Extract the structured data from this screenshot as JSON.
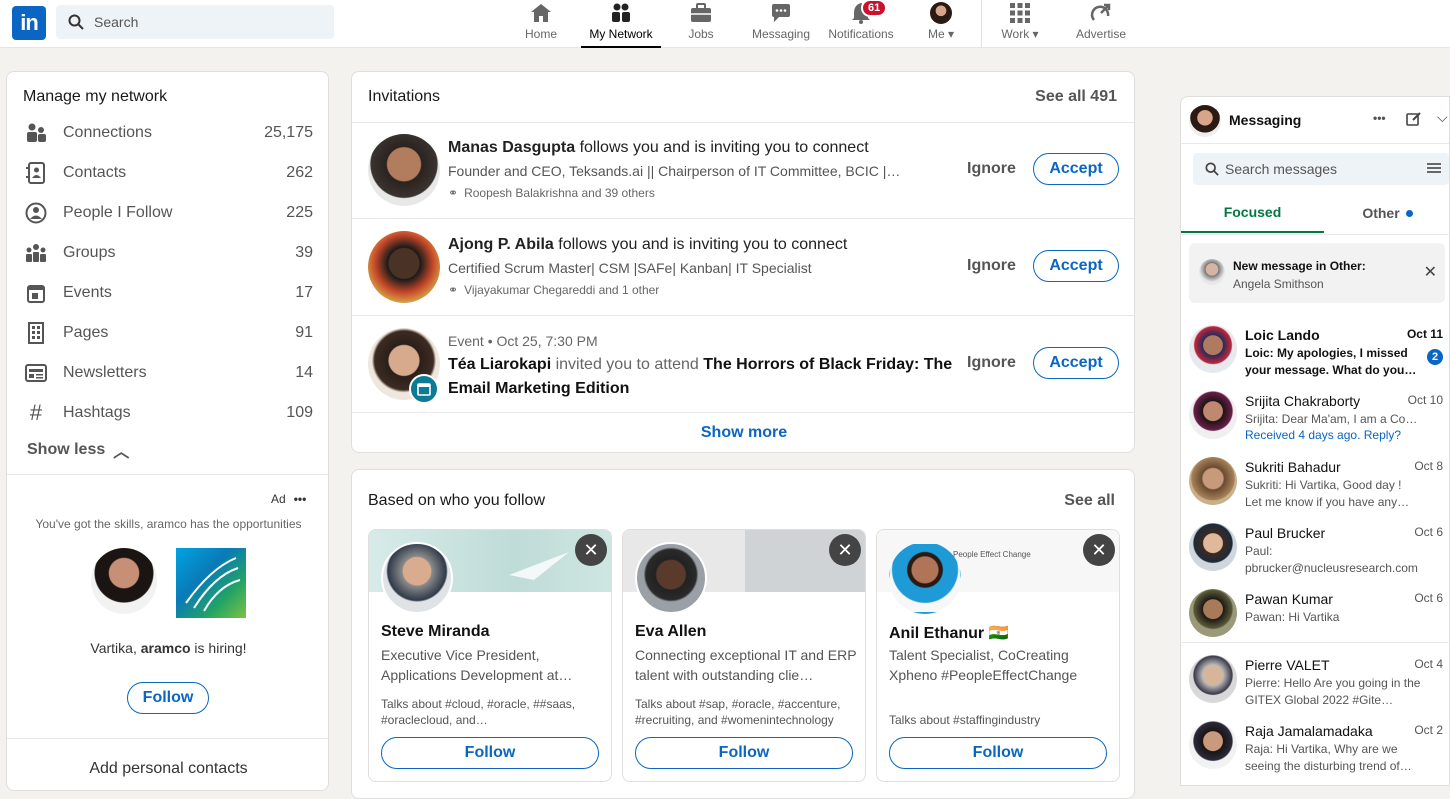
{
  "topnav": {
    "logo": "in",
    "search_placeholder": "Search",
    "items": [
      {
        "label": "Home"
      },
      {
        "label": "My Network"
      },
      {
        "label": "Jobs"
      },
      {
        "label": "Messaging"
      },
      {
        "label": "Notifications",
        "badge": "61"
      },
      {
        "label": "Me"
      },
      {
        "label": "Work"
      },
      {
        "label": "Advertise"
      }
    ]
  },
  "manage": {
    "title": "Manage my network",
    "items": [
      {
        "label": "Connections",
        "count": "25,175"
      },
      {
        "label": "Contacts",
        "count": "262"
      },
      {
        "label": "People I Follow",
        "count": "225"
      },
      {
        "label": "Groups",
        "count": "39"
      },
      {
        "label": "Events",
        "count": "17"
      },
      {
        "label": "Pages",
        "count": "91"
      },
      {
        "label": "Newsletters",
        "count": "14"
      },
      {
        "label": "Hashtags",
        "count": "109"
      }
    ],
    "show_less": "Show less"
  },
  "ad": {
    "label": "Ad",
    "tagline": "You've got the skills, aramco has the opportunities",
    "hiring_prefix": "Vartika, ",
    "hiring_company": "aramco",
    "hiring_suffix": " is hiring!",
    "follow": "Follow",
    "add_contacts": "Add personal contacts"
  },
  "invitations": {
    "title": "Invitations",
    "see_all": "See all 491",
    "ignore": "Ignore",
    "accept": "Accept",
    "show_more": "Show more",
    "items": [
      {
        "name": "Manas Dasgupta",
        "action": " follows you and is inviting you to connect",
        "headline": "Founder and CEO, Teksands.ai || Chairperson of IT Committee, BCIC ||…",
        "mutual": "Roopesh Balakrishna and 39 others"
      },
      {
        "name": "Ajong P. Abila",
        "action": " follows you and is inviting you to connect",
        "headline": "Certified Scrum Master| CSM |SAFe| Kanban| IT Specialist",
        "mutual": "Vijayakumar Chegareddi and 1 other"
      },
      {
        "event_meta": "Event • Oct 25, 7:30 PM",
        "name": "Téa Liarokapi",
        "action": " invited you to attend ",
        "event_title": "The Horrors of Black Friday: The Email Marketing Edition"
      }
    ]
  },
  "follow_section": {
    "title": "Based on who you follow",
    "see_all": "See all",
    "follow": "Follow",
    "cards": [
      {
        "name": "Steve Miranda",
        "headline": "Executive Vice President, Applications Development at…",
        "talks": "Talks about #cloud, #oracle, ##saas, #oraclecloud, and…"
      },
      {
        "name": "Eva Allen",
        "headline": "Connecting exceptional IT and ERP talent with outstanding clie…",
        "talks": "Talks about #sap, #oracle, #accenture, #recruiting, and #womenintechnology"
      },
      {
        "name": "Anil Ethanur 🇮🇳",
        "headline": "Talent Specialist, CoCreating Xpheno #PeopleEffectChange",
        "talks": "Talks about #staffingindustry",
        "banner_text": "People Effect Change"
      }
    ]
  },
  "messaging": {
    "title": "Messaging",
    "search_placeholder": "Search messages",
    "tabs": [
      {
        "label": "Focused"
      },
      {
        "label": "Other"
      }
    ],
    "notice_title": "New message in Other:",
    "notice_name": "Angela Smithson",
    "threads": [
      {
        "name": "Loic Lando",
        "date": "Oct 11",
        "preview": "Loic: My apologies, I missed your message. What do you…",
        "unread": "2"
      },
      {
        "name": "Srijita Chakraborty",
        "date": "Oct 10",
        "preview": "Srijita: Dear Ma'am, I am a Coo…",
        "extra": "Received 4 days ago. Reply?"
      },
      {
        "name": "Sukriti Bahadur",
        "date": "Oct 8",
        "preview": "Sukriti: Hi Vartika, Good day ! Let me know if you have any…"
      },
      {
        "name": "Paul Brucker",
        "date": "Oct 6",
        "preview": "Paul: pbrucker@nucleusresearch.com"
      },
      {
        "name": "Pawan Kumar",
        "date": "Oct 6",
        "preview": "Pawan: Hi Vartika"
      },
      {
        "name": "Pierre VALET",
        "date": "Oct 4",
        "preview": "Pierre: Hello Are you going in the GITEX Global 2022 #Gite…"
      },
      {
        "name": "Raja Jamalamadaka",
        "date": "Oct 2",
        "preview": "Raja: Hi Vartika, Why are we seeing the disturbing trend of…"
      }
    ]
  },
  "colors": {
    "brand": "#0a66c2",
    "focused_tab": "#057642",
    "badge": "#cb112d"
  }
}
